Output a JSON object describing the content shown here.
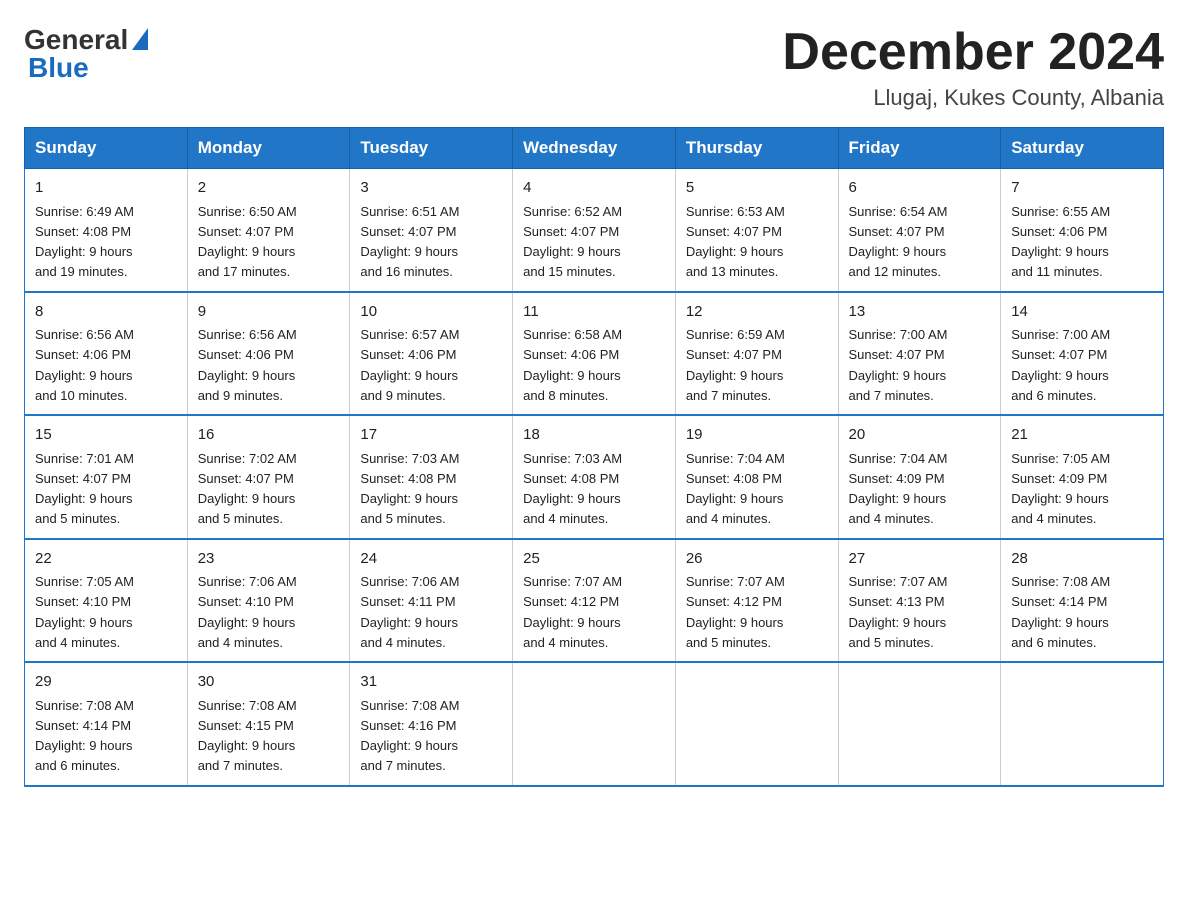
{
  "logo": {
    "general": "General",
    "blue": "Blue"
  },
  "title": "December 2024",
  "location": "Llugaj, Kukes County, Albania",
  "weekdays": [
    "Sunday",
    "Monday",
    "Tuesday",
    "Wednesday",
    "Thursday",
    "Friday",
    "Saturday"
  ],
  "weeks": [
    [
      {
        "day": "1",
        "sunrise": "6:49 AM",
        "sunset": "4:08 PM",
        "daylight": "9 hours and 19 minutes."
      },
      {
        "day": "2",
        "sunrise": "6:50 AM",
        "sunset": "4:07 PM",
        "daylight": "9 hours and 17 minutes."
      },
      {
        "day": "3",
        "sunrise": "6:51 AM",
        "sunset": "4:07 PM",
        "daylight": "9 hours and 16 minutes."
      },
      {
        "day": "4",
        "sunrise": "6:52 AM",
        "sunset": "4:07 PM",
        "daylight": "9 hours and 15 minutes."
      },
      {
        "day": "5",
        "sunrise": "6:53 AM",
        "sunset": "4:07 PM",
        "daylight": "9 hours and 13 minutes."
      },
      {
        "day": "6",
        "sunrise": "6:54 AM",
        "sunset": "4:07 PM",
        "daylight": "9 hours and 12 minutes."
      },
      {
        "day": "7",
        "sunrise": "6:55 AM",
        "sunset": "4:06 PM",
        "daylight": "9 hours and 11 minutes."
      }
    ],
    [
      {
        "day": "8",
        "sunrise": "6:56 AM",
        "sunset": "4:06 PM",
        "daylight": "9 hours and 10 minutes."
      },
      {
        "day": "9",
        "sunrise": "6:56 AM",
        "sunset": "4:06 PM",
        "daylight": "9 hours and 9 minutes."
      },
      {
        "day": "10",
        "sunrise": "6:57 AM",
        "sunset": "4:06 PM",
        "daylight": "9 hours and 9 minutes."
      },
      {
        "day": "11",
        "sunrise": "6:58 AM",
        "sunset": "4:06 PM",
        "daylight": "9 hours and 8 minutes."
      },
      {
        "day": "12",
        "sunrise": "6:59 AM",
        "sunset": "4:07 PM",
        "daylight": "9 hours and 7 minutes."
      },
      {
        "day": "13",
        "sunrise": "7:00 AM",
        "sunset": "4:07 PM",
        "daylight": "9 hours and 7 minutes."
      },
      {
        "day": "14",
        "sunrise": "7:00 AM",
        "sunset": "4:07 PM",
        "daylight": "9 hours and 6 minutes."
      }
    ],
    [
      {
        "day": "15",
        "sunrise": "7:01 AM",
        "sunset": "4:07 PM",
        "daylight": "9 hours and 5 minutes."
      },
      {
        "day": "16",
        "sunrise": "7:02 AM",
        "sunset": "4:07 PM",
        "daylight": "9 hours and 5 minutes."
      },
      {
        "day": "17",
        "sunrise": "7:03 AM",
        "sunset": "4:08 PM",
        "daylight": "9 hours and 5 minutes."
      },
      {
        "day": "18",
        "sunrise": "7:03 AM",
        "sunset": "4:08 PM",
        "daylight": "9 hours and 4 minutes."
      },
      {
        "day": "19",
        "sunrise": "7:04 AM",
        "sunset": "4:08 PM",
        "daylight": "9 hours and 4 minutes."
      },
      {
        "day": "20",
        "sunrise": "7:04 AM",
        "sunset": "4:09 PM",
        "daylight": "9 hours and 4 minutes."
      },
      {
        "day": "21",
        "sunrise": "7:05 AM",
        "sunset": "4:09 PM",
        "daylight": "9 hours and 4 minutes."
      }
    ],
    [
      {
        "day": "22",
        "sunrise": "7:05 AM",
        "sunset": "4:10 PM",
        "daylight": "9 hours and 4 minutes."
      },
      {
        "day": "23",
        "sunrise": "7:06 AM",
        "sunset": "4:10 PM",
        "daylight": "9 hours and 4 minutes."
      },
      {
        "day": "24",
        "sunrise": "7:06 AM",
        "sunset": "4:11 PM",
        "daylight": "9 hours and 4 minutes."
      },
      {
        "day": "25",
        "sunrise": "7:07 AM",
        "sunset": "4:12 PM",
        "daylight": "9 hours and 4 minutes."
      },
      {
        "day": "26",
        "sunrise": "7:07 AM",
        "sunset": "4:12 PM",
        "daylight": "9 hours and 5 minutes."
      },
      {
        "day": "27",
        "sunrise": "7:07 AM",
        "sunset": "4:13 PM",
        "daylight": "9 hours and 5 minutes."
      },
      {
        "day": "28",
        "sunrise": "7:08 AM",
        "sunset": "4:14 PM",
        "daylight": "9 hours and 6 minutes."
      }
    ],
    [
      {
        "day": "29",
        "sunrise": "7:08 AM",
        "sunset": "4:14 PM",
        "daylight": "9 hours and 6 minutes."
      },
      {
        "day": "30",
        "sunrise": "7:08 AM",
        "sunset": "4:15 PM",
        "daylight": "9 hours and 7 minutes."
      },
      {
        "day": "31",
        "sunrise": "7:08 AM",
        "sunset": "4:16 PM",
        "daylight": "9 hours and 7 minutes."
      },
      null,
      null,
      null,
      null
    ]
  ],
  "labels": {
    "sunrise": "Sunrise:",
    "sunset": "Sunset:",
    "daylight": "Daylight:"
  }
}
